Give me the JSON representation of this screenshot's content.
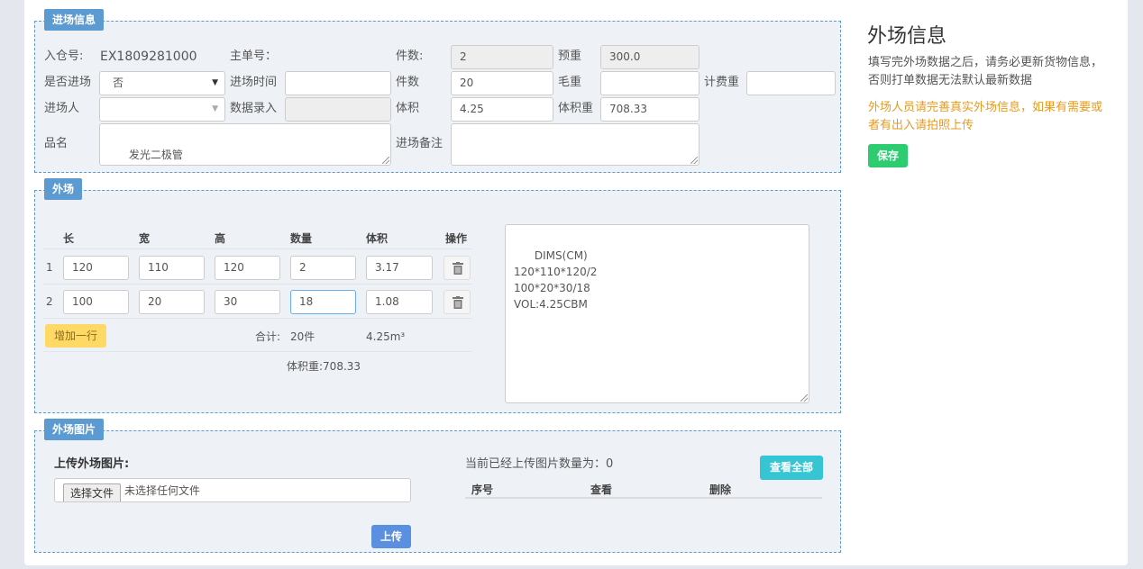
{
  "entry_section": {
    "tag": "进场信息",
    "warehouse_no_label": "入仓号:",
    "warehouse_no_value": "EX1809281000",
    "master_no_label": "主单号：",
    "pieces_label_1": "件数:",
    "pieces_value_1": "2",
    "pre_weight_label": "预重",
    "pre_weight_value": "300.0",
    "is_entered_label": "是否进场",
    "is_entered_value": "否",
    "entry_time_label": "进场时间",
    "entry_time_value": "",
    "pieces_label_2": "件数",
    "pieces_value_2": "20",
    "gross_weight_label": "毛重",
    "gross_weight_value": "",
    "charge_weight_label": "计费重",
    "charge_weight_value": "",
    "entry_person_label": "进场人",
    "entry_person_value": "",
    "data_entry_label": "数据录入",
    "data_entry_value": "",
    "volume_label": "体积",
    "volume_value": "4.25",
    "volume_weight_label": "体积重",
    "volume_weight_value": "708.33",
    "product_name_label": "品名",
    "product_name_value": "发光二极管",
    "entry_remark_label": "进场备注",
    "entry_remark_value": ""
  },
  "outfield_section": {
    "tag": "外场",
    "columns": [
      "长",
      "宽",
      "高",
      "数量",
      "体积",
      "操作"
    ],
    "rows": [
      {
        "index": "1",
        "length": "120",
        "width": "110",
        "height": "120",
        "qty": "2",
        "volume": "3.17"
      },
      {
        "index": "2",
        "length": "100",
        "width": "20",
        "height": "30",
        "qty": "18",
        "volume": "1.08"
      }
    ],
    "add_row_label": "增加一行",
    "total_label": "合计:",
    "total_qty": "20件",
    "total_volume": "4.25m³",
    "volume_weight_text": "体积重:708.33",
    "dims_text": "DIMS(CM)\n120*110*120/2\n100*20*30/18\nVOL:4.25CBM"
  },
  "photo_section": {
    "tag": "外场图片",
    "upload_label": "上传外场图片:",
    "choose_file_label": "选择文件",
    "no_file_text": "未选择任何文件",
    "upload_button": "上传",
    "count_text": "当前已经上传图片数量为：0",
    "view_all_button": "查看全部",
    "table_headers": [
      "序号",
      "查看",
      "删除"
    ]
  },
  "side": {
    "title": "外场信息",
    "note_1": "填写完外场数据之后，请务必更新货物信息，否则打单数据无法默认最新数据",
    "note_2": "外场人员请完善真实外场信息，如果有需要或者有出入请拍照上传",
    "save_button": "保存"
  },
  "colors": {
    "tag_blue": "#5c9bd1",
    "save_green": "#2ecc71",
    "add_yellow": "#ffd966",
    "view_all_cyan": "#36c6d3",
    "upload_blue": "#5b8fe0",
    "warning_orange": "#e89a1e"
  }
}
